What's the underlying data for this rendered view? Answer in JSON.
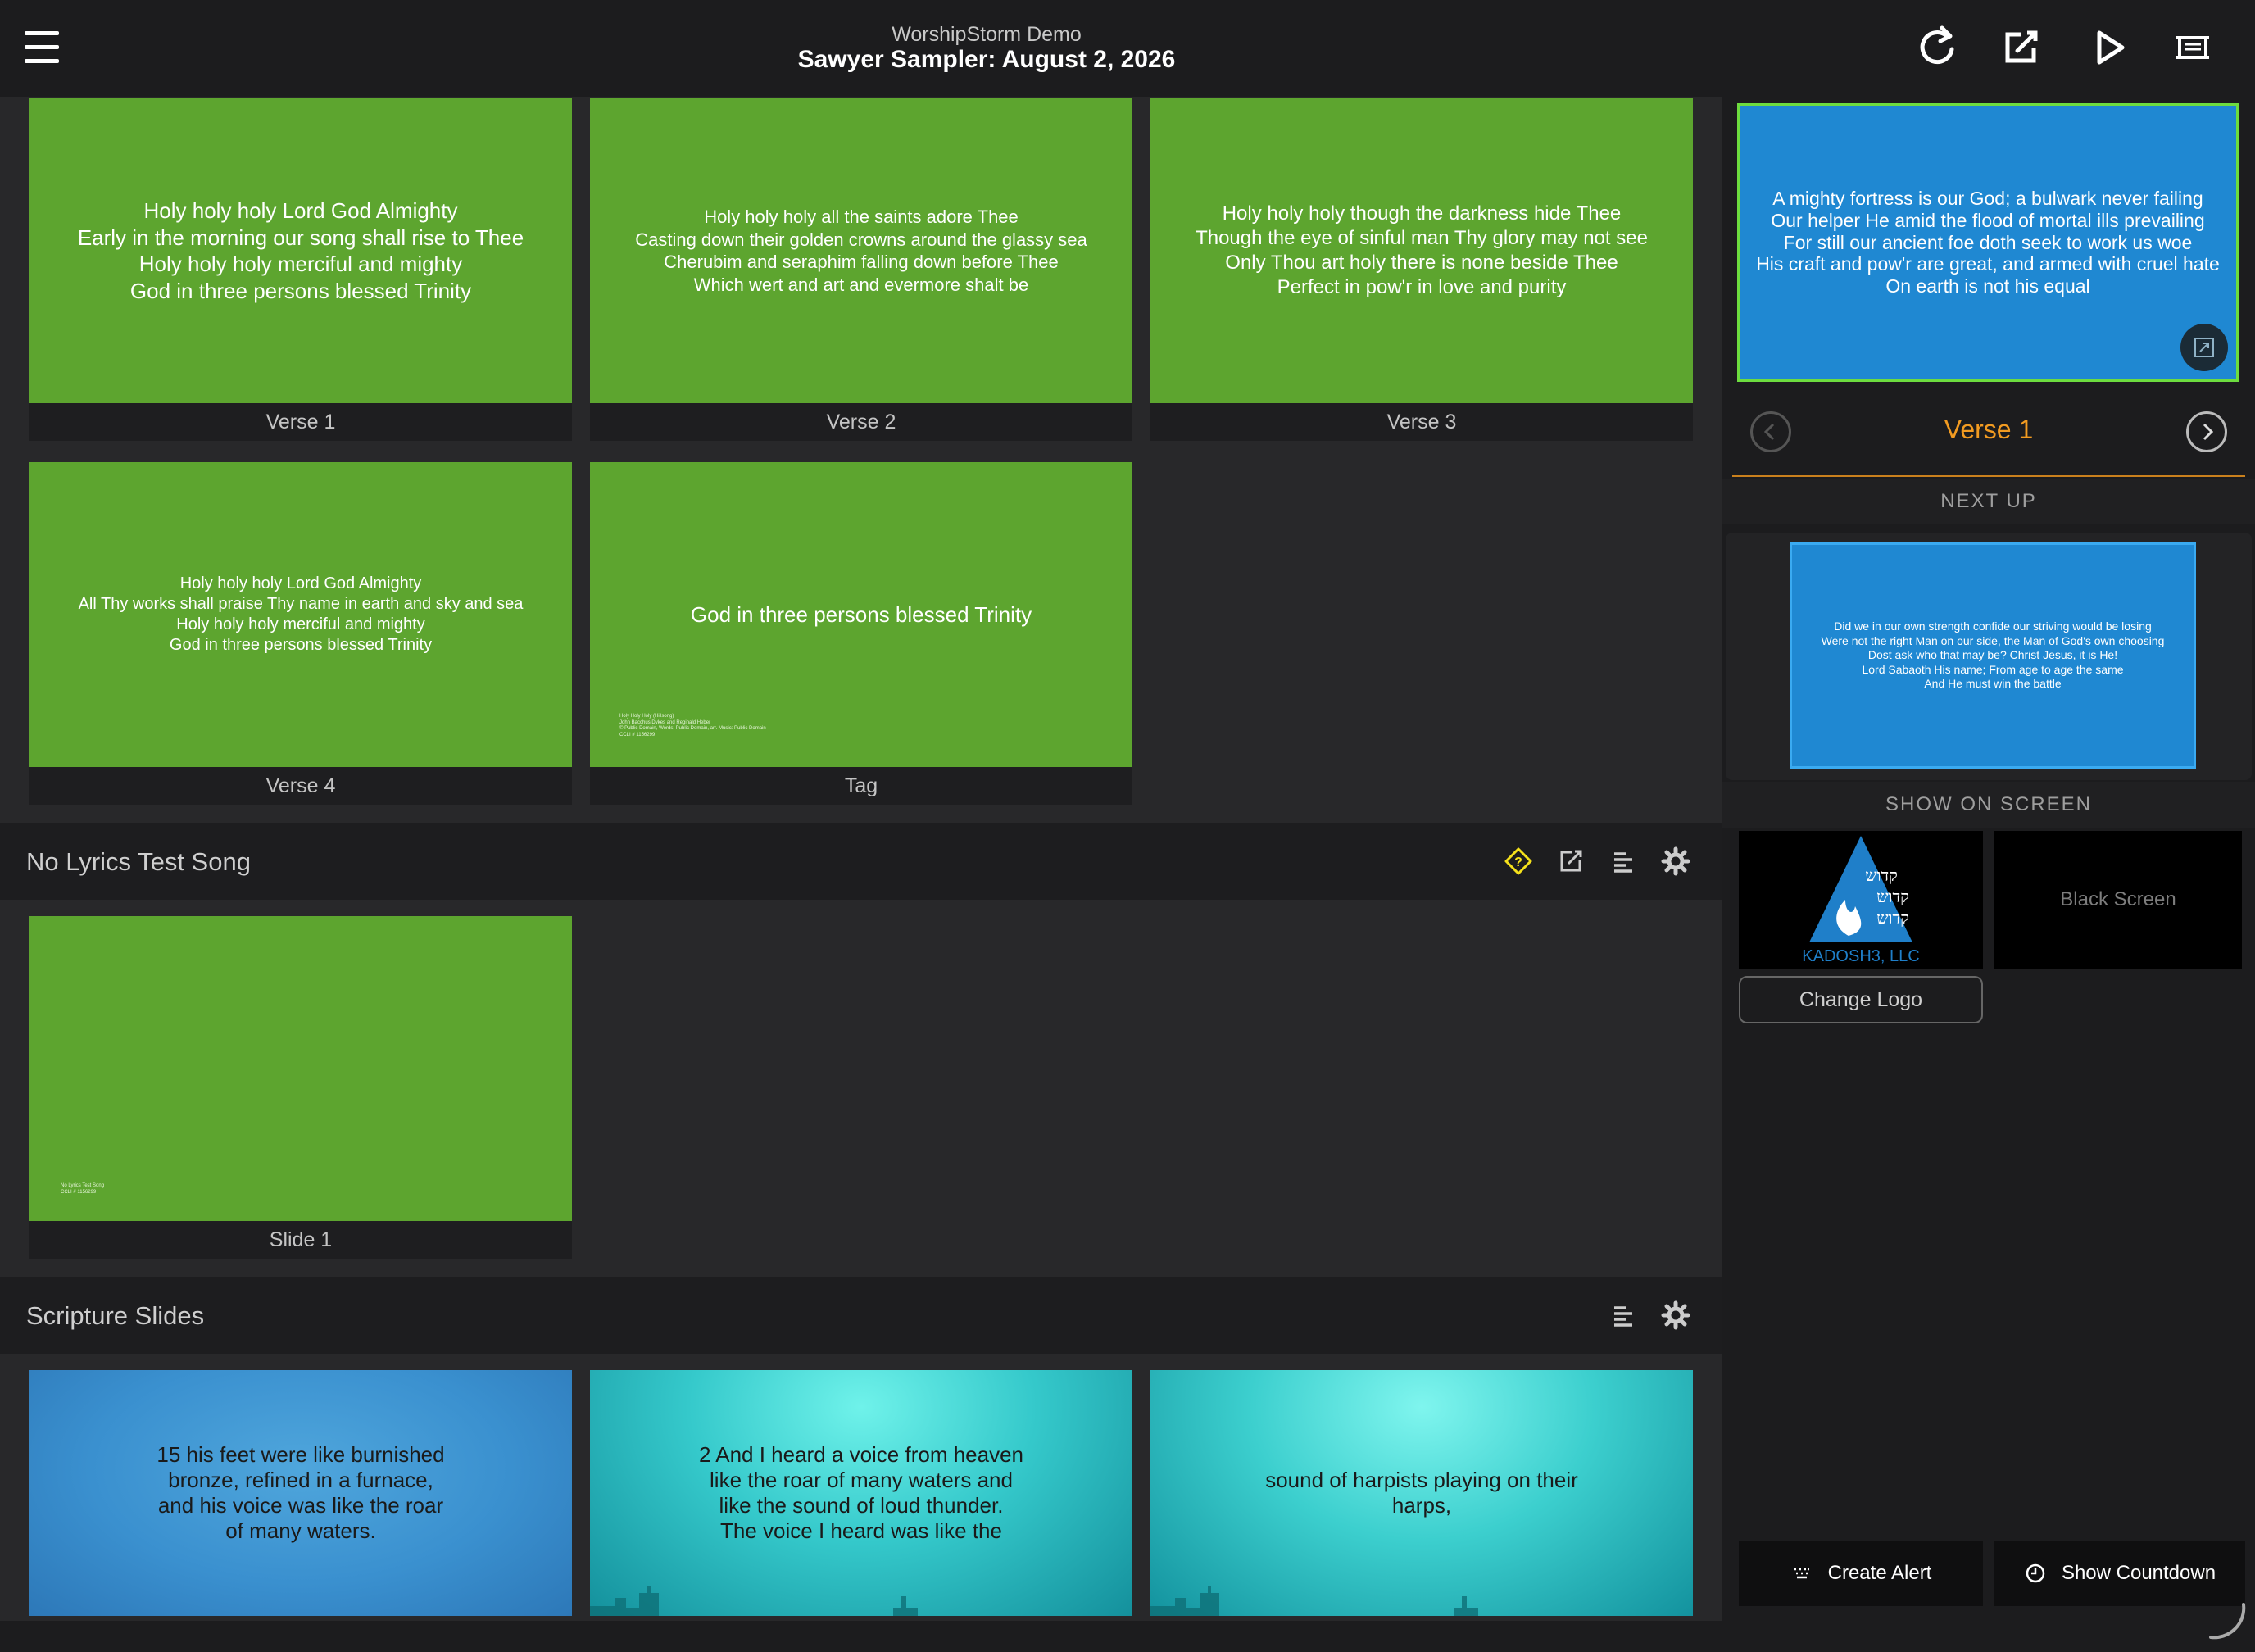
{
  "header": {
    "app_name": "WorshipStorm Demo",
    "plan_title": "Sawyer Sampler: August 2, 2026"
  },
  "song1": {
    "slides": [
      {
        "label": "Verse 1",
        "text": "Holy holy holy Lord God Almighty\nEarly in the morning our song shall rise to Thee\nHoly holy holy merciful and mighty\nGod in three persons blessed Trinity"
      },
      {
        "label": "Verse 2",
        "text": "Holy holy holy all the saints adore Thee\nCasting down their golden crowns around the glassy sea\nCherubim and seraphim falling down before Thee\nWhich wert and art and evermore shalt be"
      },
      {
        "label": "Verse 3",
        "text": "Holy holy holy though the darkness hide Thee\nThough the eye of sinful man Thy glory may not see\nOnly Thou art holy there is none beside Thee\nPerfect in pow'r in love and purity"
      },
      {
        "label": "Verse 4",
        "text": "Holy holy holy Lord God Almighty\nAll Thy works shall praise Thy name in earth and sky and sea\nHoly holy holy merciful and mighty\nGod in three persons blessed Trinity"
      },
      {
        "label": "Tag",
        "text": "God in three persons blessed Trinity",
        "fine_print": "Holy Holy Holy (Hillsong)\nJohn Bacchus Dykes and Reginald Heber\n© Public Domain, Words: Public Domain, arr. Music: Public Domain\nCCLI # 1156299"
      }
    ]
  },
  "song2": {
    "title": "No Lyrics Test Song",
    "slides": [
      {
        "label": "Slide 1",
        "fine_print": "No Lyrics Test Song\nCCLI # 1156299"
      }
    ]
  },
  "scripture": {
    "title": "Scripture Slides",
    "slides": [
      {
        "text": "15 his feet were like burnished\nbronze, refined in a furnace,\nand his voice was like the roar\nof many waters."
      },
      {
        "text": "2 And I heard a voice from heaven\nlike the roar of many waters and\nlike the sound of loud thunder.\nThe voice I heard was like the"
      },
      {
        "text": "sound of harpists playing on their\nharps,"
      }
    ]
  },
  "live": {
    "text": "A mighty fortress is our God; a bulwark never failing\nOur helper He amid the flood of mortal ills prevailing\nFor still our ancient foe doth seek to work us woe\nHis craft and pow'r are great, and armed with cruel hate\nOn earth is not his equal",
    "current_label": "Verse 1"
  },
  "next_up": {
    "heading": "NEXT UP",
    "text": "Did we in our own strength confide our striving would be losing\nWere not the right Man on our side, the Man of God's own choosing\nDost ask who that may be? Christ Jesus, it is He!\nLord Sabaoth His name; From age to age the same\nAnd He must win the battle"
  },
  "show_on_screen": {
    "heading": "SHOW ON SCREEN",
    "logo_text": "KADOSH3, LLC",
    "logo_hebrew": [
      "קדוש",
      "קדוש",
      "קדוש"
    ],
    "black_screen": "Black Screen",
    "change_logo": "Change Logo"
  },
  "actions": {
    "create_alert": "Create Alert",
    "show_countdown": "Show Countdown"
  },
  "colors": {
    "accent_orange": "#f29b21",
    "live_border": "#6ddc3f",
    "slide_green": "#5da52f",
    "slide_blue": "#1f88d2",
    "warning_yellow": "#f5e11b"
  }
}
